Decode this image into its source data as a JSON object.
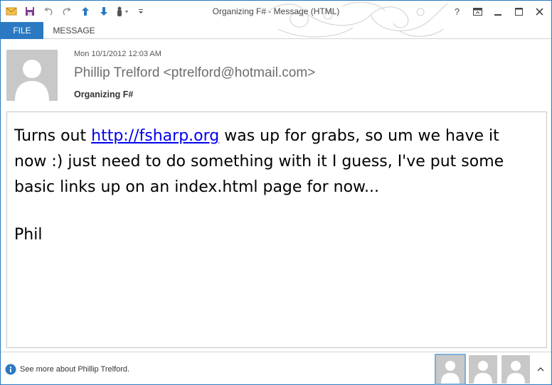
{
  "window": {
    "title": "Organizing F# - Message (HTML)"
  },
  "quick_access": {
    "icons": [
      "mail-icon",
      "save-icon",
      "undo-icon",
      "redo-icon",
      "previous-item-icon",
      "next-item-icon",
      "touch-mode-icon",
      "customize-toolbar-icon"
    ]
  },
  "window_controls": {
    "help": "?",
    "icons": [
      "help-icon",
      "ribbon-display-icon",
      "minimize-icon",
      "maximize-icon",
      "close-icon"
    ]
  },
  "ribbon": {
    "tabs": [
      {
        "label": "FILE",
        "active": true
      },
      {
        "label": "MESSAGE",
        "active": false
      }
    ],
    "file_color": "#2b79c2"
  },
  "message": {
    "date": "Mon 10/1/2012 12:03 AM",
    "sender": "Phillip Trelford <ptrelford@hotmail.com>",
    "subject": "Organizing F#",
    "body_before_link": "Turns out ",
    "link": "http://fsharp.org",
    "body_after_link": " was up for grabs, so um we have it now :) just need to do something with it I guess, I've put some basic links up on an index.html page for now...",
    "signature": "Phil"
  },
  "people_pane": {
    "see_more": "See more about Phillip Trelford.",
    "contacts": 3
  },
  "colors": {
    "accent": "#2b79c2",
    "link": "#0000ee",
    "avatar": "#c8c8c8"
  }
}
